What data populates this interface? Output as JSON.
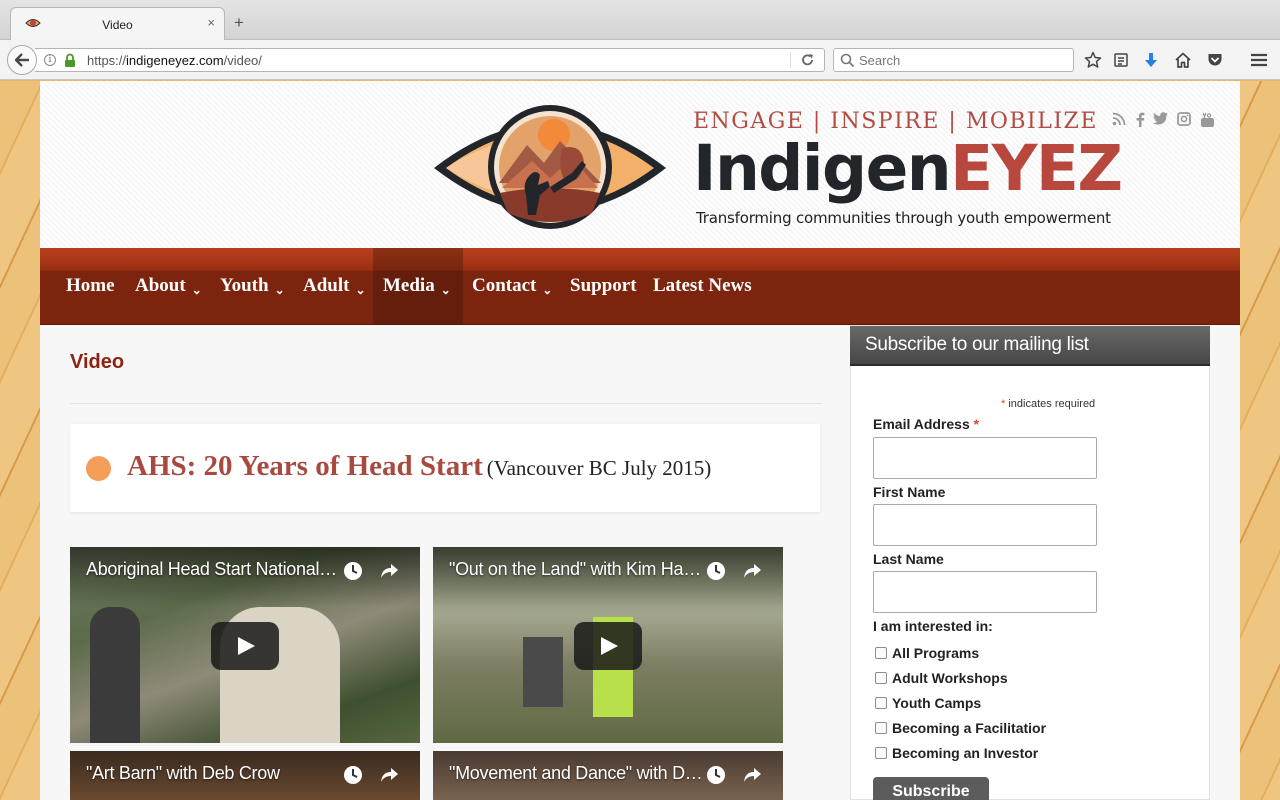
{
  "browser": {
    "tab_title": "Video",
    "tab_close": "×",
    "new_tab": "+",
    "url_prefix": "https://",
    "url_host": "indigeneyez.com",
    "url_path": "/video/",
    "search_placeholder": "Search"
  },
  "header": {
    "tagline": "ENGAGE | INSPIRE | MOBILIZE",
    "brand_part1": "Indigen",
    "brand_part2": "EYEZ",
    "subtagline": "Transforming communities through youth empowerment",
    "social_icons": [
      "rss-icon",
      "facebook-icon",
      "twitter-icon",
      "instagram-icon",
      "youtube-icon"
    ]
  },
  "menu": {
    "items": [
      {
        "label": "Home",
        "caret": ""
      },
      {
        "label": "About",
        "caret": "⌄"
      },
      {
        "label": "Youth",
        "caret": "⌄"
      },
      {
        "label": "Adult",
        "caret": "⌄"
      },
      {
        "label": "Media",
        "caret": "⌄"
      },
      {
        "label": "Contact",
        "caret": "⌄"
      },
      {
        "label": "Support",
        "caret": ""
      },
      {
        "label": "Latest News",
        "caret": ""
      }
    ],
    "active": "Media"
  },
  "main": {
    "page_title": "Video",
    "post_title": "AHS: 20 Years of Head Start",
    "post_subtitle": "(Vancouver BC July 2015)",
    "videos": [
      {
        "title": "Aboriginal Head Start National Gathering"
      },
      {
        "title": "\"Out on the Land\" with Kim Haxton"
      },
      {
        "title": "\"Art Barn\" with Deb Crow"
      },
      {
        "title": "\"Movement and Dance\" with Deb Crow"
      }
    ]
  },
  "sidebar": {
    "heading": "Subscribe to our mailing list",
    "required_star": "*",
    "required_note": "indicates required",
    "email_label": "Email Address",
    "first_name_label": "First Name",
    "last_name_label": "Last Name",
    "interest_label": "I am interested in:",
    "interests": [
      "All Programs",
      "Adult Workshops",
      "Youth Camps",
      "Becoming a Facilitatior",
      "Becoming an Investor"
    ],
    "subscribe_label": "Subscribe"
  },
  "colors": {
    "brand_red": "#b8483d",
    "menu_red": "#8a2a10",
    "title_red": "#8c2412",
    "dot_orange": "#f49e58"
  }
}
